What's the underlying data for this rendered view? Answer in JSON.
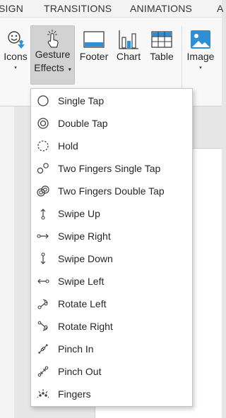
{
  "tabs": [
    "SIGN",
    "TRANSITIONS",
    "ANIMATIONS",
    "A"
  ],
  "ribbon": {
    "icons": {
      "label": "Icons",
      "caret": "▾"
    },
    "gesture": {
      "label_line1": "Gesture",
      "label_line2": "Effects",
      "caret": "▾"
    },
    "footer": {
      "label": "Footer"
    },
    "chart": {
      "label": "Chart"
    },
    "table": {
      "label": "Table"
    },
    "image": {
      "label": "Image",
      "caret": "▾"
    }
  },
  "menu": {
    "items": [
      {
        "label": "Single Tap",
        "icon": "single-tap-icon"
      },
      {
        "label": "Double Tap",
        "icon": "double-tap-icon"
      },
      {
        "label": "Hold",
        "icon": "hold-icon"
      },
      {
        "label": "Two Fingers Single Tap",
        "icon": "two-fingers-single-tap-icon"
      },
      {
        "label": "Two Fingers Double Tap",
        "icon": "two-fingers-double-tap-icon"
      },
      {
        "label": "Swipe Up",
        "icon": "swipe-up-icon"
      },
      {
        "label": "Swipe Right",
        "icon": "swipe-right-icon"
      },
      {
        "label": "Swipe Down",
        "icon": "swipe-down-icon"
      },
      {
        "label": "Swipe Left",
        "icon": "swipe-left-icon"
      },
      {
        "label": "Rotate Left",
        "icon": "rotate-left-icon"
      },
      {
        "label": "Rotate Right",
        "icon": "rotate-right-icon"
      },
      {
        "label": "Pinch In",
        "icon": "pinch-in-icon"
      },
      {
        "label": "Pinch Out",
        "icon": "pinch-out-icon"
      },
      {
        "label": "Fingers",
        "icon": "fingers-icon"
      }
    ]
  },
  "colors": {
    "accent": "#2e8fd6",
    "icon_stroke": "#404040",
    "active_bg": "#d2d2d2"
  }
}
